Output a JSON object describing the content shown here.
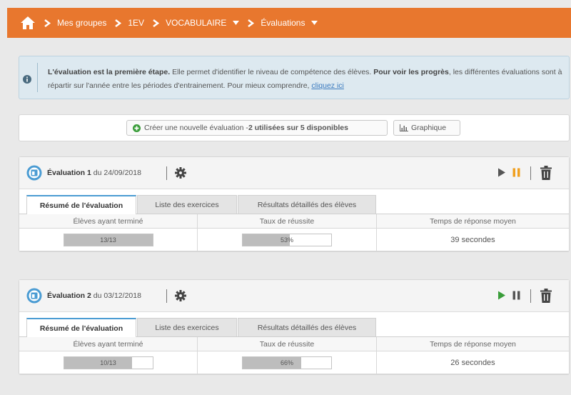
{
  "breadcrumb": {
    "items": [
      "Mes groupes",
      "1EV",
      "VOCABULAIRE",
      "Évaluations"
    ]
  },
  "colors": {
    "brand": "#e8772e",
    "play_active": "#3a9d3a",
    "pause_active": "#f0a020",
    "tab_accent": "#4b9cd3"
  },
  "info": {
    "bold1": "L'évaluation est la première étape.",
    "text1": " Elle permet d'identifier le niveau de compétence des élèves. ",
    "bold2": "Pour voir les progrès",
    "text2": ", les différentes évaluations sont à répartir sur l'année entre les périodes d'entrainement. Pour mieux comprendre, ",
    "link": "cliquez ici"
  },
  "actions": {
    "create_label": "Créer une nouvelle évaluation - ",
    "create_usage": "2 utilisées sur 5 disponibles",
    "graph_label": "Graphique"
  },
  "tabs": [
    "Résumé de l'évaluation",
    "Liste des exercices",
    "Résultats détaillés des élèves"
  ],
  "columns": [
    "Élèves ayant terminé",
    "Taux de réussite",
    "Temps de réponse moyen"
  ],
  "evaluations": [
    {
      "name": "Évaluation 1",
      "date": " du 24/09/2018",
      "finished_label": "13/13",
      "finished_fraction": 1.0,
      "success_label": "53%",
      "success_fraction": 0.53,
      "avg_time": "39 secondes",
      "playing": false,
      "paused": true
    },
    {
      "name": "Évaluation 2",
      "date": " du 03/12/2018",
      "finished_label": "10/13",
      "finished_fraction": 0.77,
      "success_label": "66%",
      "success_fraction": 0.66,
      "avg_time": "26 secondes",
      "playing": true,
      "paused": false
    }
  ]
}
